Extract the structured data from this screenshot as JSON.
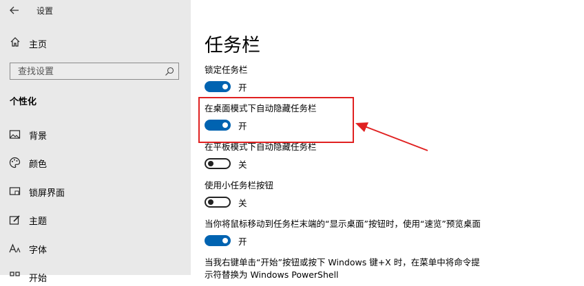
{
  "window": {
    "title": "设置"
  },
  "sidebar": {
    "home": "主页",
    "search_placeholder": "查找设置",
    "section": "个性化",
    "items": [
      {
        "label": "背景",
        "icon": "image-icon"
      },
      {
        "label": "颜色",
        "icon": "palette-icon"
      },
      {
        "label": "锁屏界面",
        "icon": "lock-screen-icon"
      },
      {
        "label": "主题",
        "icon": "theme-icon"
      },
      {
        "label": "字体",
        "icon": "font-icon"
      },
      {
        "label": "开始",
        "icon": "start-icon"
      }
    ]
  },
  "main": {
    "title": "任务栏",
    "settings": [
      {
        "label": "锁定任务栏",
        "on": true,
        "state": "开"
      },
      {
        "label": "在桌面模式下自动隐藏任务栏",
        "on": true,
        "state": "开"
      },
      {
        "label": "在平板模式下自动隐藏任务栏",
        "on": false,
        "state": "关"
      },
      {
        "label": "使用小任务栏按钮",
        "on": false,
        "state": "关"
      },
      {
        "label": "当你将鼠标移动到任务栏末端的“显示桌面”按钮时，使用“速览”预览桌面",
        "on": true,
        "state": "开"
      }
    ],
    "footer_line1": "当我右键单击“开始”按钮或按下 Windows 键+X 时，在菜单中将命令提",
    "footer_line2": "示符替换为 Windows PowerShell"
  },
  "colors": {
    "accent": "#0063b1",
    "annotation": "#e02020",
    "sidebar_bg": "#e9e9e9"
  }
}
